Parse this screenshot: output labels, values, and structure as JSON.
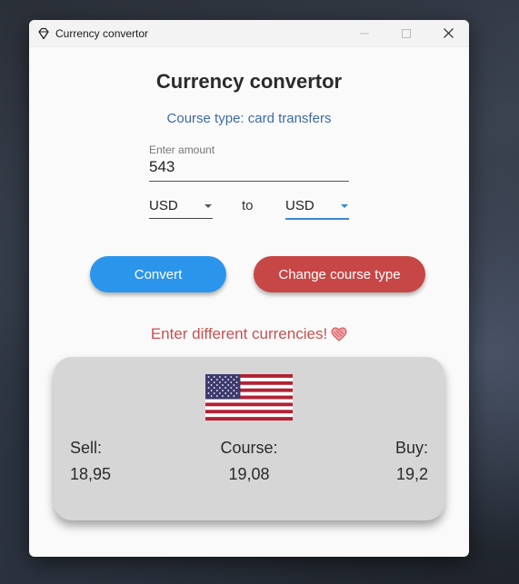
{
  "window": {
    "title": "Currency convertor",
    "app_icon": "diamond-icon",
    "controls": [
      "minimize-icon",
      "maximize-icon",
      "close-icon"
    ]
  },
  "header": {
    "title": "Currency convertor",
    "course_type": "Course type: card transfers"
  },
  "amount": {
    "label": "Enter amount",
    "value": "543"
  },
  "from_currency": {
    "selected": "USD"
  },
  "to_label": "to",
  "to_currency": {
    "selected": "USD"
  },
  "buttons": {
    "convert": "Convert",
    "change_course": "Change course type"
  },
  "message": {
    "text": "Enter different currencies!",
    "icon": "heart-icon"
  },
  "result_card": {
    "flag": "us-flag",
    "sell_label": "Sell:",
    "sell_value": "18,95",
    "course_label": "Course:",
    "course_value": "19,08",
    "buy_label": "Buy:",
    "buy_value": "19,2"
  },
  "colors": {
    "primary": "#2b95ec",
    "danger": "#c74646",
    "accent_text": "#3d6aa8",
    "warning_text": "#c95050"
  }
}
